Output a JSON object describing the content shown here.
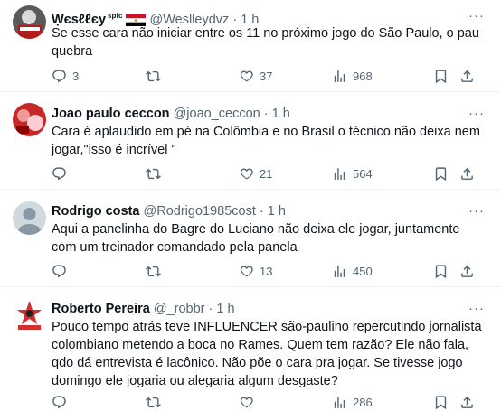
{
  "tweets": [
    {
      "name": "Ẉєѕℓℓєу",
      "name_suffix": "spfc",
      "handle": "@Weslleydvz",
      "dot": "·",
      "time": "1 h",
      "text": "Se esse cara não iniciar entre os 11 no próximo jogo do São Paulo, o pau quebra",
      "replies": "3",
      "retweets": "",
      "likes": "37",
      "views": "968"
    },
    {
      "name": "Joao paulo ceccon",
      "handle": "@joao_ceccon",
      "dot": "·",
      "time": "1 h",
      "text": "Cara é aplaudido em pé na Colômbia e no Brasil o técnico não deixa nem jogar,\"isso é incrível \"",
      "replies": "",
      "retweets": "",
      "likes": "21",
      "views": "564"
    },
    {
      "name": "Rodrigo costa",
      "handle": "@Rodrigo1985cost",
      "dot": "·",
      "time": "1 h",
      "text": "Aqui a panelinha do Bagre do Luciano não deixa ele jogar, juntamente com um treinador comandado pela panela",
      "replies": "",
      "retweets": "",
      "likes": "13",
      "views": "450"
    },
    {
      "name": "Roberto Pereira",
      "handle": "@_robbr",
      "dot": "·",
      "time": "1 h",
      "text": "Pouco tempo atrás teve INFLUENCER são-paulino repercutindo jornalista colombiano metendo a boca no Rames. Quem tem razão? Ele não fala, qdo dá entrevista é lacônico. Não põe o cara pra jogar. Se tivesse jogo domingo ele jogaria ou alegaria algum desgaste?",
      "replies": "",
      "retweets": "",
      "likes": "",
      "views": "286"
    }
  ],
  "more_label": "···",
  "colors": {
    "text": "#0f1419",
    "muted": "#536471",
    "divider": "#eff3f4"
  },
  "icons": [
    "reply-icon",
    "retweet-icon",
    "like-icon",
    "views-icon",
    "bookmark-icon",
    "share-icon",
    "more-icon"
  ]
}
